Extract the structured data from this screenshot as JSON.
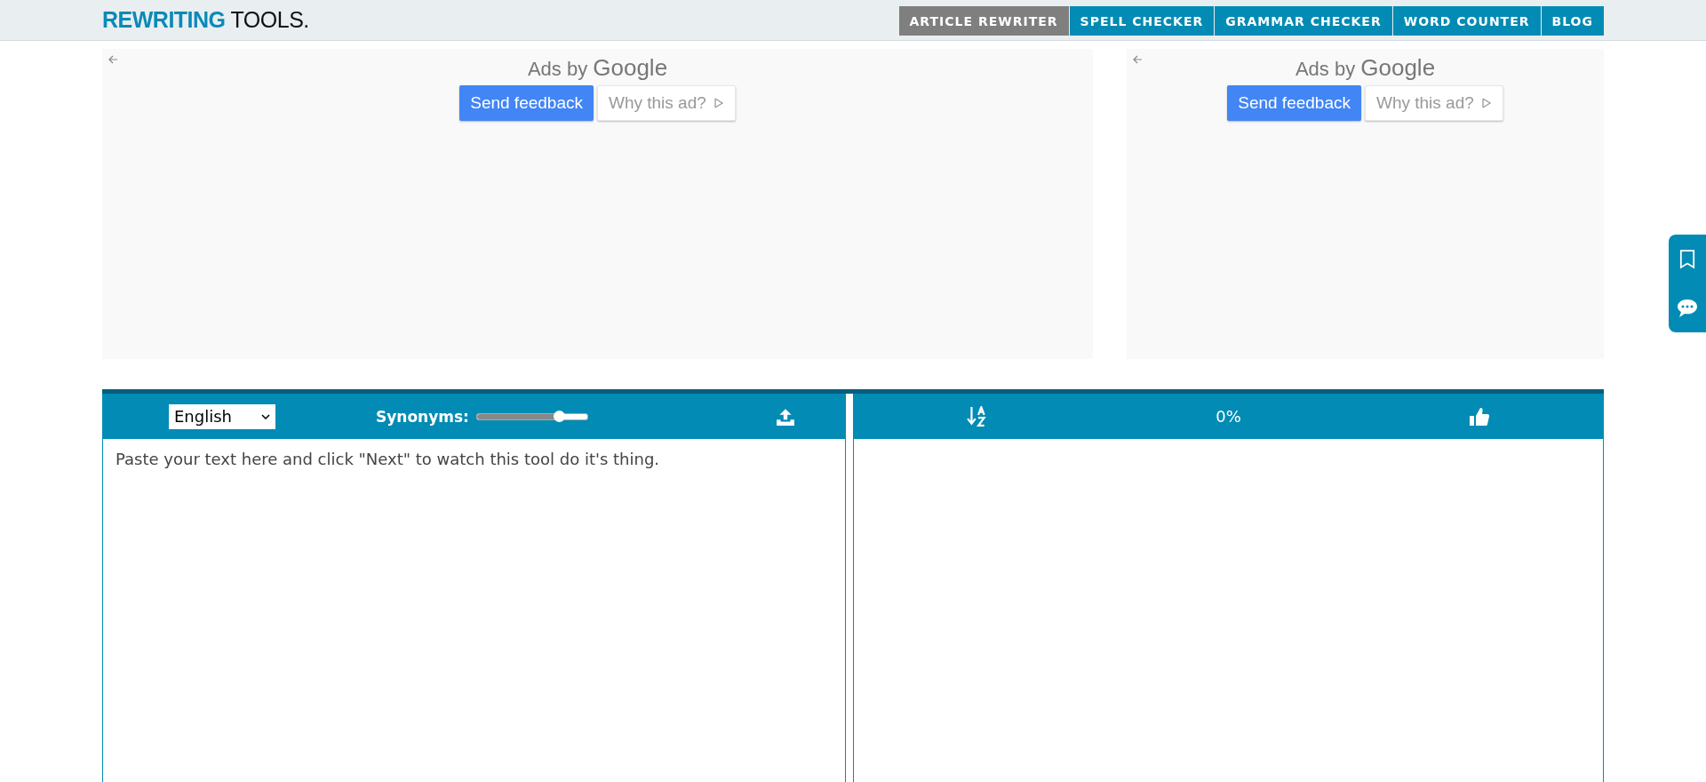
{
  "header": {
    "logo": {
      "bold": "REWRITING",
      "light": "TOOLS."
    },
    "nav": [
      {
        "label": "ARTICLE REWRITER",
        "selected": true
      },
      {
        "label": "SPELL CHECKER",
        "selected": false
      },
      {
        "label": "GRAMMAR CHECKER",
        "selected": false
      },
      {
        "label": "WORD COUNTER",
        "selected": false
      },
      {
        "label": "BLOG",
        "selected": false
      }
    ]
  },
  "ads": [
    {
      "ads_by": "Ads by",
      "brand": "Google",
      "feedback_button": "Send feedback",
      "why_button": "Why this ad?"
    },
    {
      "ads_by": "Ads by",
      "brand": "Google",
      "feedback_button": "Send feedback",
      "why_button": "Why this ad?"
    }
  ],
  "tool": {
    "language": "English",
    "synonyms": {
      "label": "Synonyms:",
      "level": 0.74
    },
    "percent": "0%",
    "input": {
      "placeholder": "Paste your text here and click \"Next\" to watch this tool do it's thing."
    }
  }
}
